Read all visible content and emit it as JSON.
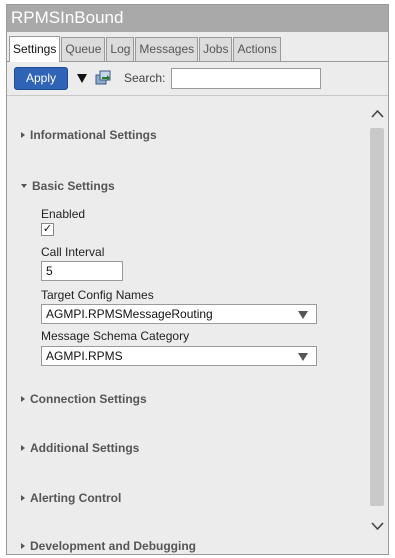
{
  "window": {
    "title": "RPMSInBound"
  },
  "tabs": [
    {
      "label": "Settings",
      "active": true
    },
    {
      "label": "Queue"
    },
    {
      "label": "Log"
    },
    {
      "label": "Messages"
    },
    {
      "label": "Jobs"
    },
    {
      "label": "Actions"
    }
  ],
  "toolbar": {
    "apply_label": "Apply",
    "search_label": "Search:",
    "search_value": ""
  },
  "sections": {
    "informational": "Informational Settings",
    "basic": "Basic Settings",
    "connection": "Connection Settings",
    "additional": "Additional Settings",
    "alerting": "Alerting Control",
    "development": "Development and Debugging"
  },
  "basic": {
    "enabled_label": "Enabled",
    "enabled_checked": true,
    "enabled_mark": "✓",
    "call_interval_label": "Call Interval",
    "call_interval_value": "5",
    "target_config_label": "Target Config Names",
    "target_config_value": "AGMPI.RPMSMessageRouting",
    "schema_category_label": "Message Schema Category",
    "schema_category_value": "AGMPI.RPMS"
  },
  "icons": {
    "filter": "filter-icon",
    "refresh": "refresh-icon",
    "scroll_up": "chevron-up-icon",
    "scroll_down": "chevron-down-icon"
  },
  "colors": {
    "titlebar": "#a9a9a9",
    "apply_button": "#2e63b6",
    "panel_bg": "#ececec"
  }
}
